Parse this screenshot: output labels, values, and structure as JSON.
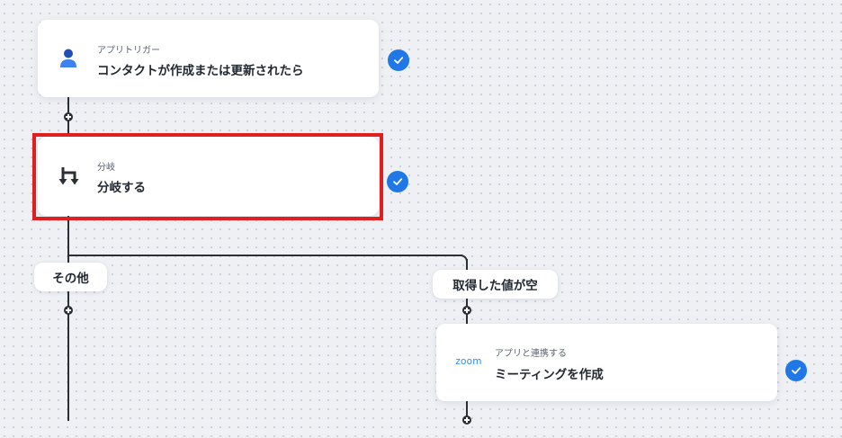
{
  "nodes": {
    "trigger": {
      "subtitle": "アプリトリガー",
      "title": "コンタクトが作成または更新されたら",
      "icon": "person-icon"
    },
    "branch": {
      "subtitle": "分岐",
      "title": "分岐する",
      "icon": "branch-icon"
    },
    "action": {
      "subtitle": "アプリと連携する",
      "title": "ミーティングを作成",
      "logo_text": "zoom"
    }
  },
  "branches": {
    "left_label": "その他",
    "right_label": "取得した値が空"
  },
  "colors": {
    "check": "#1f78e6",
    "highlight": "#e02020",
    "line": "#2b2f36",
    "zoom": "#2d8cff"
  }
}
